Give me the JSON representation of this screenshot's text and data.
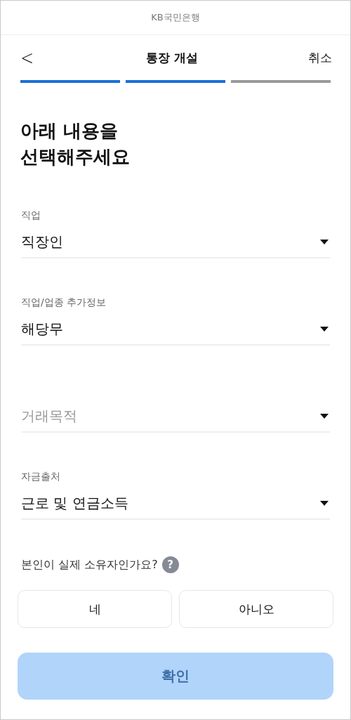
{
  "top_bar": {
    "brand": "KB국민은행"
  },
  "nav": {
    "back_icon": "<",
    "title": "통장 개설",
    "cancel": "취소"
  },
  "progress": [
    {
      "done": true
    },
    {
      "done": true
    },
    {
      "done": false
    }
  ],
  "heading": [
    "아래 내용을",
    "선택해주세요"
  ],
  "fields": [
    {
      "label": "직업",
      "value": "직장인"
    },
    {
      "label": "직업/업종 추가정보",
      "value": "해당무"
    },
    {
      "placeholder": "거래목적"
    },
    {
      "label": "자금출처",
      "value": "근로 및 연금소득"
    }
  ],
  "question": {
    "text": "본인이 실제 소유자인가요?",
    "help_icon": "?"
  },
  "options": [
    {
      "label": "네",
      "selected": false
    },
    {
      "label": "아니오",
      "selected": false
    }
  ],
  "confirm": {
    "label": "확인",
    "disabled": true
  }
}
